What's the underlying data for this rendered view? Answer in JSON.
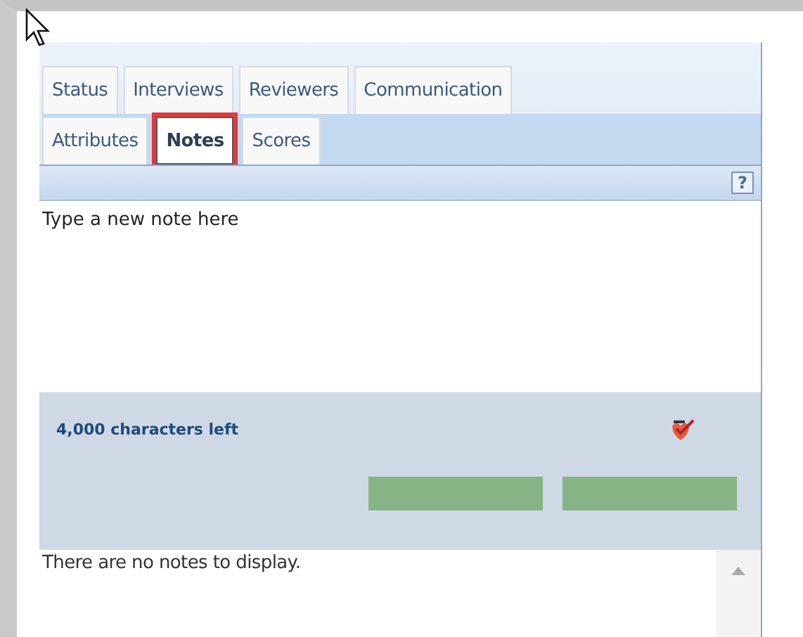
{
  "tab_rows": [
    [
      {
        "label": "Status",
        "selected": false
      },
      {
        "label": "Interviews",
        "selected": false
      },
      {
        "label": "Reviewers",
        "selected": false
      },
      {
        "label": "Communication",
        "selected": false
      }
    ],
    [
      {
        "label": "Attributes",
        "selected": false
      },
      {
        "label": "Notes",
        "selected": true
      },
      {
        "label": "Scores",
        "selected": false
      }
    ]
  ],
  "help_button": "?",
  "note_field": {
    "placeholder": "Type a new note here"
  },
  "characters_left": "4,000 characters left",
  "buttons": [
    {
      "disabled": true
    },
    {
      "disabled": true
    }
  ],
  "notes_list": {
    "empty_message": "There are no notes to display."
  }
}
